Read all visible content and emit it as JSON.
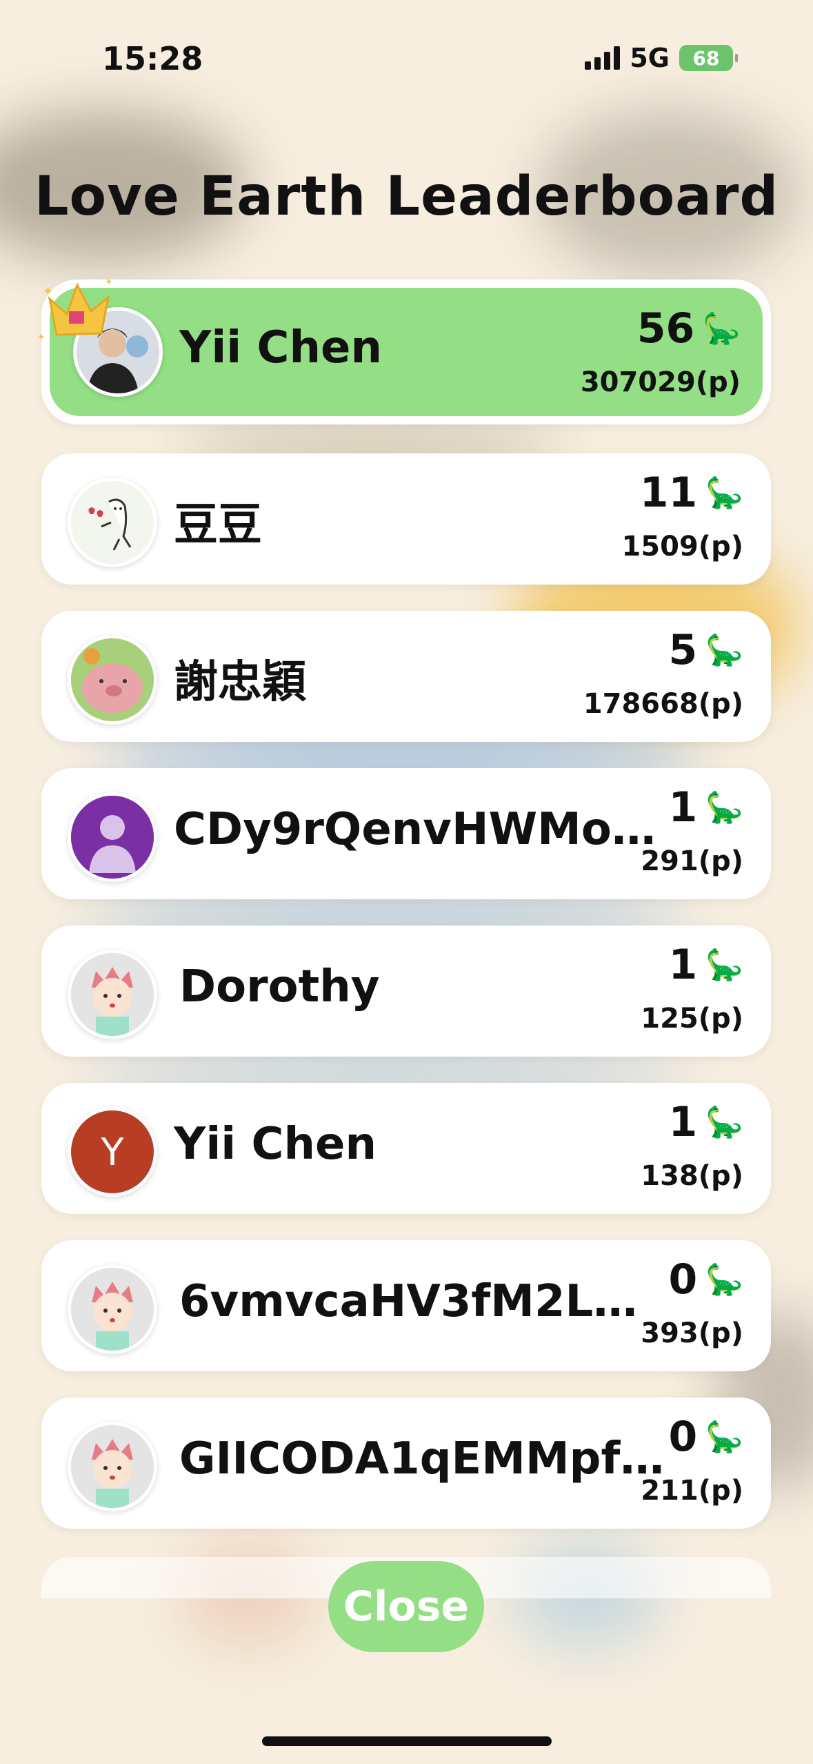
{
  "status_bar": {
    "time": "15:28",
    "network": "5G",
    "battery": "68"
  },
  "title": "Love Earth Leaderboard",
  "entries": [
    {
      "name": "Yii Chen",
      "count": "56",
      "points": "307029(p)",
      "avatar": "photo",
      "highlighted": true
    },
    {
      "name": "豆豆",
      "count": "11",
      "points": "1509(p)",
      "avatar": "sketch-character"
    },
    {
      "name": "謝忠穎",
      "count": "5",
      "points": "178668(p)",
      "avatar": "pig-character"
    },
    {
      "name": "CDy9rQenvHWMo…",
      "count": "1",
      "points": "291(p)",
      "avatar": "default-person"
    },
    {
      "name": "Dorothy",
      "count": "1",
      "points": "125(p)",
      "avatar": "cartoon-kid"
    },
    {
      "name": "Yii Chen",
      "count": "1",
      "points": "138(p)",
      "avatar": "letter",
      "initial": "Y"
    },
    {
      "name": "6vmvcaHV3fM2L…",
      "count": "0",
      "points": "393(p)",
      "avatar": "cartoon-kid"
    },
    {
      "name": "GIICODA1qEMMpf…",
      "count": "0",
      "points": "211(p)",
      "avatar": "cartoon-kid"
    }
  ],
  "dino_icon": "🦕",
  "close_label": "Close",
  "colors": {
    "highlight": "#94df85",
    "background": "#f7eedf",
    "letter_avatar": "#b73e24",
    "default_avatar": "#7a2fa5"
  }
}
